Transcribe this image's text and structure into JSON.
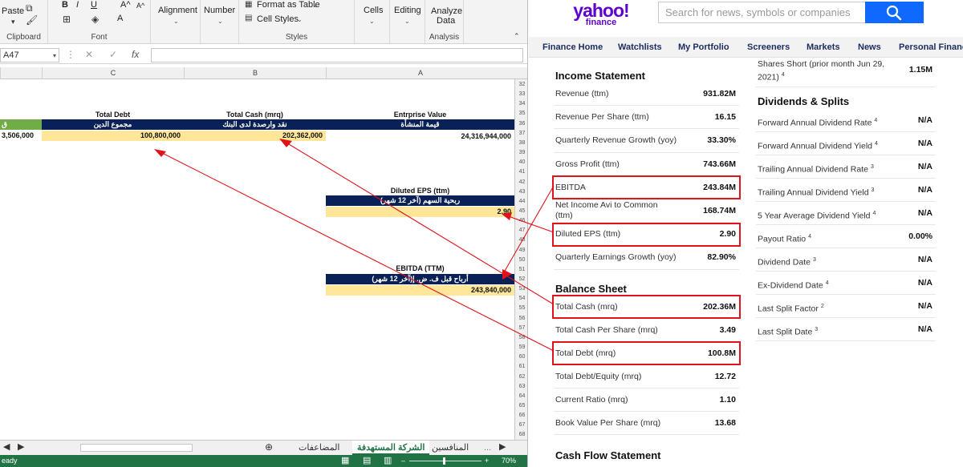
{
  "excel": {
    "ribbon": {
      "paste": "Paste",
      "clipboard_group": "Clipboard",
      "bold": "B",
      "italic": "I",
      "underline": "U",
      "grow_font": "A^",
      "shrink_font": "A^",
      "font_color": "A",
      "font_group": "Font",
      "alignment": "Alignment",
      "number": "Number",
      "format_as_table": "Format as Table",
      "cell_styles": "Cell Styles",
      "styles_group": "Styles",
      "cells": "Cells",
      "editing": "Editing",
      "analyze_line1": "Analyze",
      "analyze_line2": "Data",
      "analysis_group": "Analysis"
    },
    "name_box": "A47",
    "fx": "fx",
    "columns": [
      "C",
      "B",
      "A"
    ],
    "rows": [
      "32",
      "33",
      "34",
      "35",
      "36",
      "37",
      "38",
      "39",
      "40",
      "41",
      "42",
      "43",
      "44",
      "45",
      "46",
      "47",
      "48",
      "49",
      "50",
      "51",
      "52",
      "53",
      "54",
      "55",
      "56",
      "57",
      "58",
      "59",
      "60",
      "61",
      "62",
      "63",
      "64",
      "65",
      "66",
      "67",
      "68"
    ],
    "cells": {
      "total_debt_en": "Total Debt",
      "total_cash_en": "Total Cash (mrq)",
      "ev_en": "Entrprise Value",
      "total_debt_ar": "مجموع الدين",
      "total_cash_ar": "نقد وارصدة لدى البنك",
      "ev_ar": "قيمة المنشأة",
      "partial_left": "3,506,000",
      "partial_green": "ق",
      "total_debt_val": "100,800,000",
      "total_cash_val": "202,362,000",
      "ev_val": "24,316,944,000",
      "eps_en": "Diluted EPS (ttm)",
      "eps_ar": "ربحية السهم (آخر 12 شهر)",
      "eps_val": "2.90",
      "ebitda_en": "EBITDA (TTM)",
      "ebitda_ar": "أرباح قبل ف. ض. إ(آخر 12 شهر)",
      "ebitda_val": "243,840,000"
    },
    "sheet_tabs": [
      "المضاعفات",
      "الشركة المستهدفة",
      "المنافسين"
    ],
    "active_tab": "الشركة المستهدفة",
    "tab_ellipsis": "...",
    "status_ready": "eady",
    "zoom": "70%"
  },
  "yahoo": {
    "logo_main": "yahoo!",
    "logo_sub": "finance",
    "search_placeholder": "Search for news, symbols or companies",
    "nav": [
      "Finance Home",
      "Watchlists",
      "My Portfolio",
      "Screeners",
      "Markets",
      "News",
      "Personal Finance"
    ],
    "income_statement": {
      "title": "Income Statement",
      "rows": [
        {
          "label": "Revenue (ttm)",
          "value": "931.82M"
        },
        {
          "label": "Revenue Per Share (ttm)",
          "value": "16.15"
        },
        {
          "label": "Quarterly Revenue Growth (yoy)",
          "value": "33.30%"
        },
        {
          "label": "Gross Profit (ttm)",
          "value": "743.66M"
        },
        {
          "label": "EBITDA",
          "value": "243.84M"
        },
        {
          "label": "Net Income Avi to Common (ttm)",
          "value": "168.74M"
        },
        {
          "label": "Diluted EPS (ttm)",
          "value": "2.90"
        },
        {
          "label": "Quarterly Earnings Growth (yoy)",
          "value": "82.90%"
        }
      ]
    },
    "balance_sheet": {
      "title": "Balance Sheet",
      "rows": [
        {
          "label": "Total Cash (mrq)",
          "value": "202.36M"
        },
        {
          "label": "Total Cash Per Share (mrq)",
          "value": "3.49"
        },
        {
          "label": "Total Debt (mrq)",
          "value": "100.8M"
        },
        {
          "label": "Total Debt/Equity (mrq)",
          "value": "12.72"
        },
        {
          "label": "Current Ratio (mrq)",
          "value": "1.10"
        },
        {
          "label": "Book Value Per Share (mrq)",
          "value": "13.68"
        }
      ]
    },
    "cash_flow": {
      "title": "Cash Flow Statement"
    },
    "shares_short": {
      "label": "Shares Short (prior month Jun 29, 2021)",
      "sup": "4",
      "value": "1.15M"
    },
    "dividends": {
      "title": "Dividends & Splits",
      "rows": [
        {
          "label": "Forward Annual Dividend Rate",
          "sup": "4",
          "value": "N/A"
        },
        {
          "label": "Forward Annual Dividend Yield",
          "sup": "4",
          "value": "N/A"
        },
        {
          "label": "Trailing Annual Dividend Rate",
          "sup": "3",
          "value": "N/A"
        },
        {
          "label": "Trailing Annual Dividend Yield",
          "sup": "3",
          "value": "N/A"
        },
        {
          "label": "5 Year Average Dividend Yield",
          "sup": "4",
          "value": "N/A"
        },
        {
          "label": "Payout Ratio",
          "sup": "4",
          "value": "0.00%"
        },
        {
          "label": "Dividend Date",
          "sup": "3",
          "value": "N/A"
        },
        {
          "label": "Ex-Dividend Date",
          "sup": "4",
          "value": "N/A"
        },
        {
          "label": "Last Split Factor",
          "sup": "2",
          "value": "N/A"
        },
        {
          "label": "Last Split Date",
          "sup": "3",
          "value": "N/A"
        }
      ]
    }
  },
  "colors": {
    "navy": "#0a2158",
    "cream": "#ffe699",
    "excel_green": "#217346",
    "yahoo_purple": "#5f01d1",
    "highlight_red": "#e0131a"
  }
}
